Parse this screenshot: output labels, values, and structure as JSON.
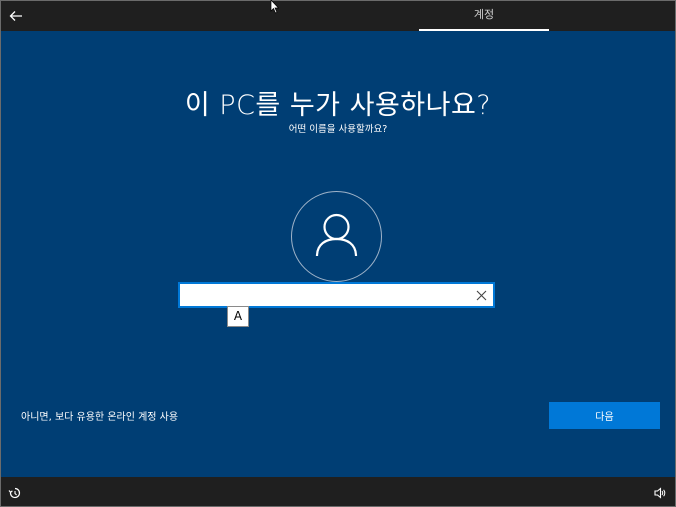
{
  "header": {
    "tab_label": "계정"
  },
  "main": {
    "title": "이 PC를 누가 사용하나요?",
    "subtitle": "어떤 이름을 사용할까요?",
    "name_input": {
      "value": "",
      "placeholder": ""
    },
    "ime_indicator": "A",
    "online_account_link": "아니면, 보다 유용한 온라인 계정 사용",
    "next_button": "다음"
  },
  "colors": {
    "background": "#003e74",
    "accent": "#0078d7",
    "bar": "#1f1f1f"
  },
  "icons": [
    "back-arrow-icon",
    "user-icon",
    "clear-icon",
    "accessibility-icon",
    "volume-icon",
    "mouse-cursor-icon"
  ]
}
